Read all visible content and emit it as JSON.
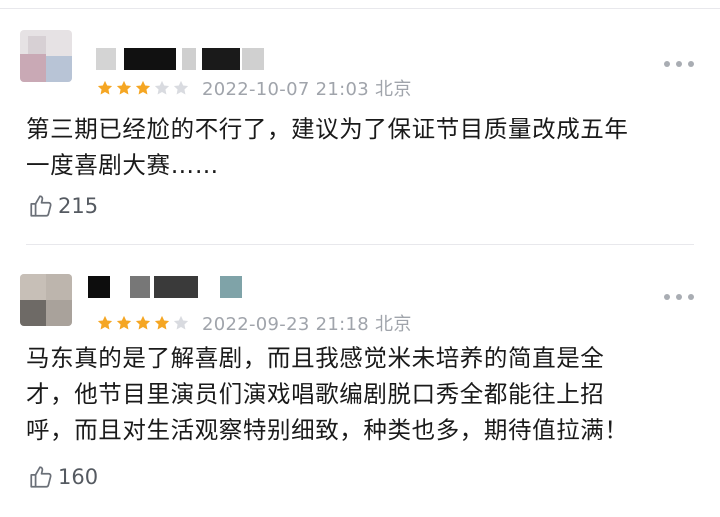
{
  "reviews": [
    {
      "rating": 3,
      "max_rating": 5,
      "date_location": "2022-10-07 21:03 北京",
      "content_lines": [
        "第三期已经尬的不行了，建议为了保证节目质量改成五年",
        "一度喜剧大赛……"
      ],
      "likes": "215"
    },
    {
      "rating": 4,
      "max_rating": 5,
      "date_location": "2022-09-23 21:18 北京",
      "content_lines": [
        "马东真的是了解喜剧，而且我感觉米未培养的简直是全",
        "才，他节目里演员们演戏唱歌编剧脱口秀全都能往上招",
        "呼，而且对生活观察特别细致，种类也多，期待值拉满！"
      ],
      "likes": "160"
    }
  ],
  "icons": {
    "more": "more-dots-icon",
    "like": "thumbs-up-icon",
    "star": "star-icon"
  },
  "colors": {
    "star_filled": "#f5a623",
    "star_empty": "#d9dbe0",
    "meta_text": "#a0a4ab"
  }
}
